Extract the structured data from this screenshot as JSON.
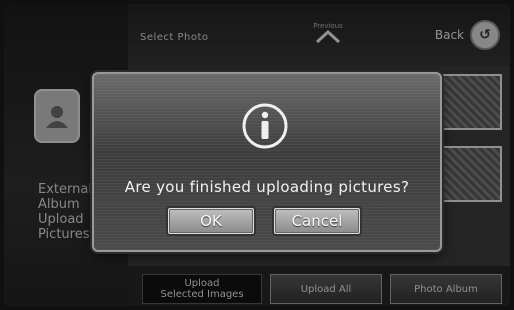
{
  "header": {
    "title": "Select Photo",
    "up_label": "Previous",
    "back_label": "Back"
  },
  "sidebar": {
    "label": "External\nAlbum\nUpload\nPictures"
  },
  "bottombar": {
    "upload_selected": "Upload\nSelected Images",
    "upload_all": "Upload All",
    "photo_album": "Photo Album"
  },
  "dialog": {
    "message": "Are you finished uploading pictures?",
    "ok_label": "OK",
    "cancel_label": "Cancel",
    "icon": "info-icon"
  }
}
